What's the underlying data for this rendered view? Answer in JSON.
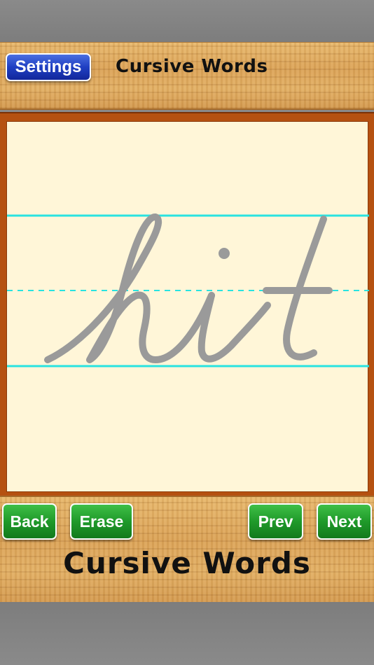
{
  "header": {
    "settings_label": "Settings",
    "title": "Cursive Words"
  },
  "practice": {
    "word": "hit",
    "guide_line_color": "#29e3e0",
    "letter_color": "#9a9a9a"
  },
  "footer": {
    "back_label": "Back",
    "erase_label": "Erase",
    "prev_label": "Prev",
    "next_label": "Next",
    "title": "Cursive Words"
  },
  "colors": {
    "settings_button": "#1f3fc2",
    "nav_buttons": "#1f9a2a",
    "board_frame": "#b55111",
    "paper": "#fff6d8"
  }
}
